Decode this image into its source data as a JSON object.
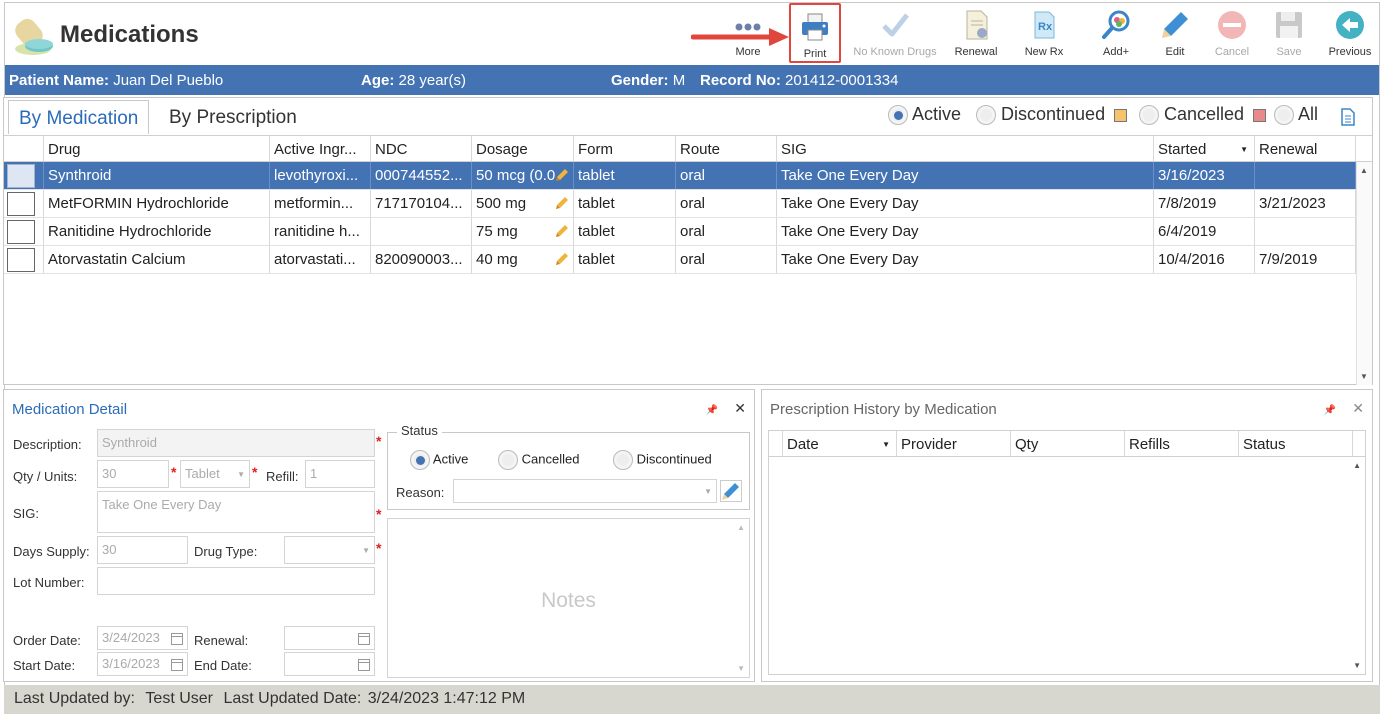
{
  "app": {
    "title": "Medications"
  },
  "toolbar": {
    "more": "More",
    "print": "Print",
    "no_known_drugs": "No Known Drugs",
    "renewal": "Renewal",
    "new_rx": "New Rx",
    "add_plus": "Add+",
    "edit": "Edit",
    "cancel": "Cancel",
    "save": "Save",
    "previous": "Previous"
  },
  "patient": {
    "name_label": "Patient Name:",
    "name": "Juan Del Pueblo",
    "age_label": "Age:",
    "age": "28 year(s)",
    "gender_label": "Gender:",
    "gender": "M",
    "record_label": "Record No:",
    "record": "201412-0001334"
  },
  "tabs": [
    "By Medication",
    "By Prescription"
  ],
  "filters": {
    "active": "Active",
    "discontinued": "Discontinued",
    "cancelled": "Cancelled",
    "all": "All"
  },
  "colors": {
    "accent": "#4473b4",
    "discontinued_swatch": "#f5c36b",
    "cancelled_swatch": "#e98a8a",
    "highlight": "#e0463b"
  },
  "grid": {
    "columns": [
      "Drug",
      "Active Ingr...",
      "NDC",
      "Dosage",
      "Form",
      "Route",
      "SIG",
      "Started",
      "Renewal"
    ],
    "rows": [
      {
        "drug": "Synthroid",
        "ingredient": "levothyroxi...",
        "ndc": "000744552...",
        "dosage": "50 mcg (0.0",
        "form": "tablet",
        "route": "oral",
        "sig": "Take One Every Day",
        "started": "3/16/2023",
        "renewal": ""
      },
      {
        "drug": "MetFORMIN Hydrochloride",
        "ingredient": "metformin...",
        "ndc": "717170104...",
        "dosage": "500 mg",
        "form": "tablet",
        "route": "oral",
        "sig": "Take One Every Day",
        "started": "7/8/2019",
        "renewal": "3/21/2023"
      },
      {
        "drug": "Ranitidine Hydrochloride",
        "ingredient": "ranitidine h...",
        "ndc": "",
        "dosage": "75 mg",
        "form": "tablet",
        "route": "oral",
        "sig": "Take One Every Day",
        "started": "6/4/2019",
        "renewal": ""
      },
      {
        "drug": "Atorvastatin Calcium",
        "ingredient": "atorvastati...",
        "ndc": "820090003...",
        "dosage": "40 mg",
        "form": "tablet",
        "route": "oral",
        "sig": "Take One Every Day",
        "started": "10/4/2016",
        "renewal": "7/9/2019"
      }
    ]
  },
  "detail": {
    "title": "Medication Detail",
    "description_label": "Description:",
    "description": "Synthroid",
    "qty_label": "Qty / Units:",
    "qty": "30",
    "units": "Tablet",
    "refill_label": "Refill:",
    "refill": "1",
    "sig_label": "SIG:",
    "sig": "Take One Every Day",
    "days_label": "Days Supply:",
    "days": "30",
    "drug_type_label": "Drug Type:",
    "lot_label": "Lot Number:",
    "order_date_label": "Order Date:",
    "order_date": "3/24/2023",
    "renewal_label": "Renewal:",
    "start_date_label": "Start Date:",
    "start_date": "3/16/2023",
    "end_date_label": "End Date:",
    "status_legend": "Status",
    "status_active": "Active",
    "status_cancelled": "Cancelled",
    "status_discontinued": "Discontinued",
    "reason_label": "Reason:",
    "notes_placeholder": "Notes"
  },
  "history": {
    "title": "Prescription History by Medication",
    "columns": [
      "Date",
      "Provider",
      "Qty",
      "Refills",
      "Status"
    ]
  },
  "status_bar": {
    "updated_by_label": "Last Updated by:",
    "updated_by": "Test User",
    "updated_date_label": "Last Updated Date:",
    "updated_date": "3/24/2023 1:47:12 PM"
  }
}
